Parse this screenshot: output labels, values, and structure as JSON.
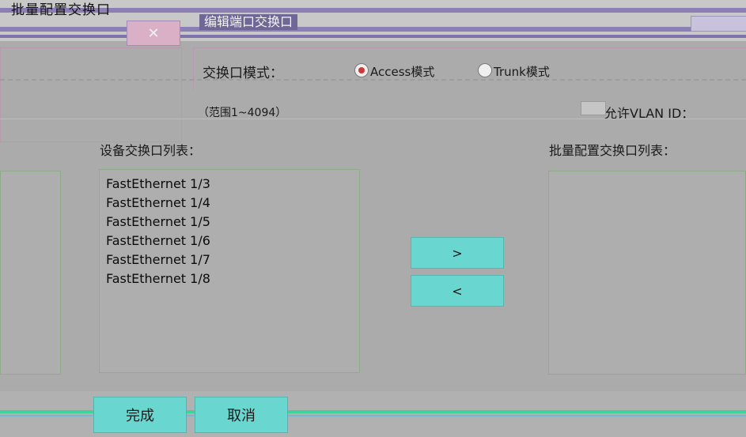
{
  "window": {
    "title": "批量配置交换口",
    "subtitle": "编辑端口交换口",
    "close_glyph": "✕"
  },
  "mode": {
    "label": "交换口模式：",
    "options": [
      {
        "label": "Access模式",
        "selected": true
      },
      {
        "label": "Trunk模式",
        "selected": false
      }
    ]
  },
  "vlan": {
    "range_text": "（范围1~4094）",
    "allowed_label": "允许VLAN ID："
  },
  "lists": {
    "device_label": "设备交换口列表：",
    "batch_label": "批量配置交换口列表：",
    "device_ports": [
      "FastEthernet 1/3",
      "FastEthernet 1/4",
      "FastEthernet 1/5",
      "FastEthernet 1/6",
      "FastEthernet 1/7",
      "FastEthernet 1/8"
    ],
    "batch_ports": []
  },
  "buttons": {
    "move_right": ">",
    "move_left": "<",
    "finish": "完成",
    "cancel": "取消"
  },
  "colors": {
    "accent": "#6ad6d0",
    "title_band": "#8c7fb6",
    "radio_selected": "#d03838"
  }
}
